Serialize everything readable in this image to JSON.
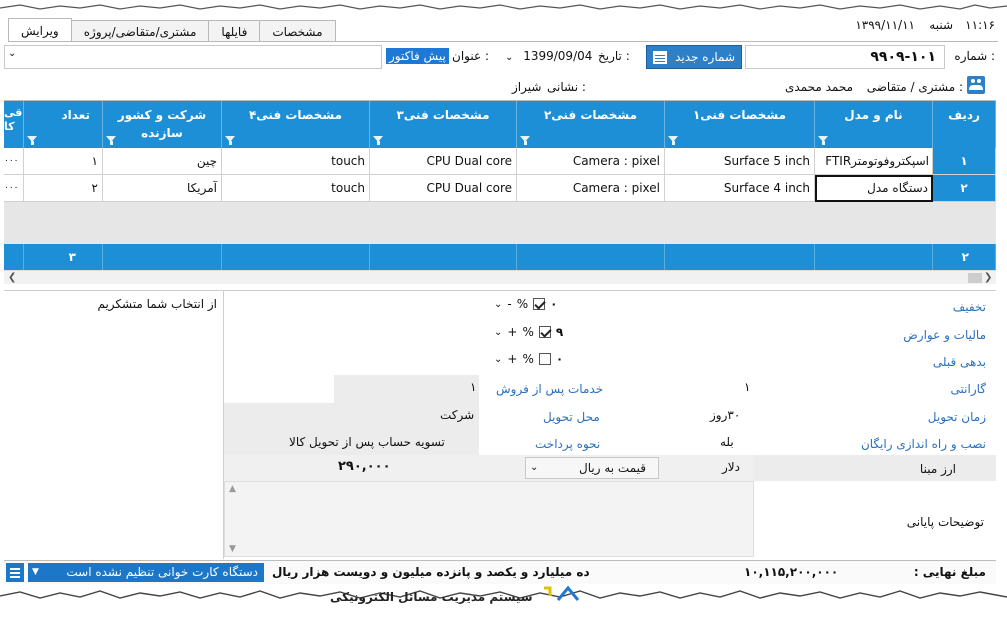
{
  "header": {
    "time": "۱۱:۱۶",
    "day": "شنبه",
    "date": "۱۳۹۹/۱۱/۱۱"
  },
  "tabs": [
    {
      "label": "ویرایش"
    },
    {
      "label": "مشتری/متقاضی/پروژه"
    },
    {
      "label": "فایلها"
    },
    {
      "label": "مشخصات"
    }
  ],
  "form": {
    "number_label": "شماره :",
    "number_value": "۹۹۰۹-۱۰۱",
    "new_number_button": "شماره جدید",
    "date_label": "تاریخ :",
    "date_value": "1399/09/04",
    "title_label": "عنوان :",
    "title_value": "پیش فاکتور",
    "customer_label": "مشتری / متقاضی :",
    "customer_value": "محمد محمدی",
    "address_label": "نشانی :",
    "address_value": "شیراز"
  },
  "grid": {
    "columns": [
      {
        "label": "ردیف"
      },
      {
        "label": "نام و مدل"
      },
      {
        "label": "مشخصات فنی۱"
      },
      {
        "label": "مشخصات فنی۲"
      },
      {
        "label": "مشخصات فنی۳"
      },
      {
        "label": "مشخصات فنی۴"
      },
      {
        "label": "شرکت و کشور سازنده"
      },
      {
        "label": "تعداد"
      },
      {
        "label": "قی کا"
      }
    ],
    "rows": [
      {
        "num": "۱",
        "name": "اسپکتروفوتومترFTIR",
        "spec1": "Surface 5 inch",
        "spec2": "Camera :  pixel",
        "spec3": "CPU Dual core",
        "spec4": "touch",
        "maker": "چین",
        "qty": "۱",
        "price": "۰۰۰"
      },
      {
        "num": "۲",
        "name": "دستگاه مدل",
        "spec1": "Surface 4 inch",
        "spec2": "Camera :  pixel",
        "spec3": "CPU Dual core",
        "spec4": "touch",
        "maker": "آمریکا",
        "qty": "۲",
        "price": "۰۰۰"
      }
    ],
    "footer_count": "۲",
    "footer_qty": "۳"
  },
  "lower": {
    "thanks_note": "از انتخاب شما متشکریم",
    "discount_label": "تخفیف",
    "discount_value": "۰",
    "tax_label": "مالیات و عوارض",
    "tax_value": "۹",
    "debt_label": "بدهی قبلی",
    "debt_value": "۰",
    "percent": "%",
    "minus": "-",
    "plus": "+",
    "warranty_label": "گارانتی",
    "warranty_value": "۱",
    "aftersales_label": "خدمات پس از فروش",
    "aftersales_value": "۱",
    "delivery_time_label": "زمان تحویل",
    "delivery_time_value": "۳۰روز",
    "delivery_place_label": "محل تحویل",
    "delivery_place_value": "شرکت",
    "install_label": "نصب و راه اندازی رایگان",
    "install_value": "بله",
    "payment_label": "نحوه پرداخت",
    "payment_value": "تسویه حساب پس از تحویل کالا",
    "base_currency_label": "ارز مبنا",
    "base_currency_value": "دلار",
    "rial_price_label": "قیمت به ریال",
    "rial_price_value": "۲۹۰,۰۰۰",
    "final_desc_label": "توضیحات پایانی"
  },
  "status": {
    "final_amount_label": "مبلغ نهایی :",
    "final_amount_value": "۱۰,۱۱۵,۲۰۰,۰۰۰",
    "final_amount_words": "ده میلیارد و یکصد و پانزده میلیون و دویست  هزار  ریال",
    "card_reader": "دستگاه کارت خوانی تنظیم نشده است",
    "bottom_partial": "سیستم مدیریت مسائل الکترونیکی"
  },
  "colors": {
    "accent": "#1c8fd6",
    "link": "#2a70c0",
    "selection": "#1e78d6"
  }
}
